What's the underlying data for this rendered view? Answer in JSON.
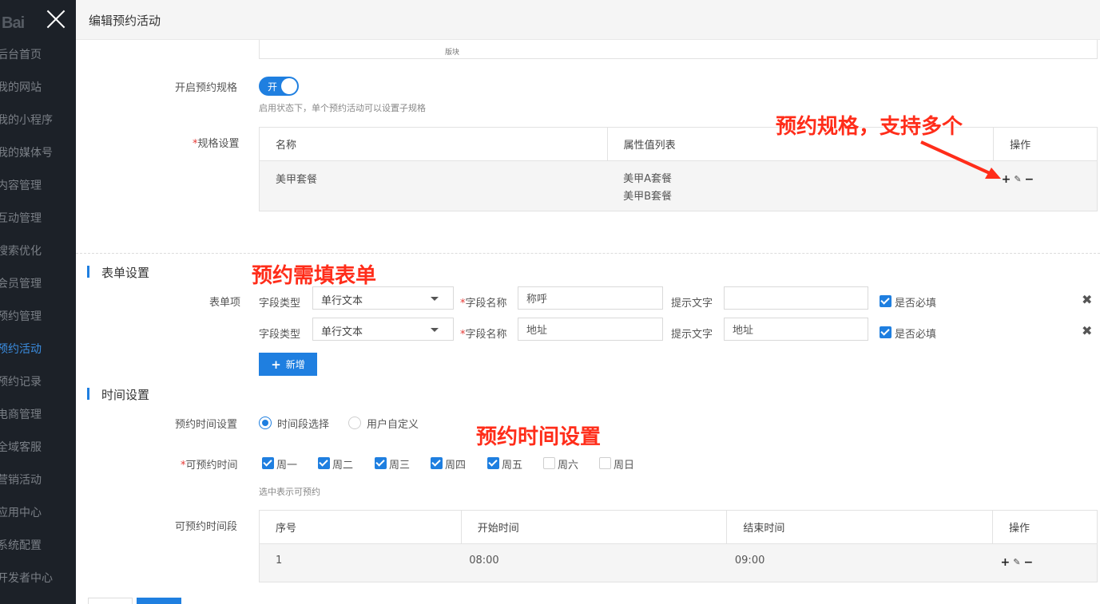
{
  "sidebar": {
    "logo_text": "Bai",
    "items": [
      {
        "label": "后台首页"
      },
      {
        "label": "我的网站"
      },
      {
        "label": "我的小程序"
      },
      {
        "label": "我的媒体号"
      },
      {
        "label": "内容管理"
      },
      {
        "label": "互动管理"
      },
      {
        "label": "搜索优化"
      },
      {
        "label": "会员管理"
      },
      {
        "label": "预约管理"
      },
      {
        "label": "预约活动"
      },
      {
        "label": "预约记录"
      },
      {
        "label": "电商管理"
      },
      {
        "label": "全域客服"
      },
      {
        "label": "营销活动"
      },
      {
        "label": "应用中心"
      },
      {
        "label": "系统配置"
      },
      {
        "label": "开发者中心"
      }
    ],
    "active_index": 9
  },
  "header": {
    "title": "编辑预约活动"
  },
  "top_box": {
    "caption": "版块"
  },
  "spec": {
    "enable_label": "开启预约规格",
    "switch_text": "开",
    "switch_on": true,
    "hint": "启用状态下，单个预约活动可以设置子规格",
    "settings_label": "规格设置",
    "table": {
      "headers": [
        "名称",
        "属性值列表",
        "操作"
      ],
      "rows": [
        {
          "name": "美甲套餐",
          "values": [
            "美甲A套餐",
            "美甲B套餐"
          ]
        }
      ]
    }
  },
  "form": {
    "section_title": "表单设置",
    "item_label": "表单项",
    "field_type_label": "字段类型",
    "field_name_label": "字段名称",
    "hint_label": "提示文字",
    "required_label": "是否必填",
    "rows": [
      {
        "type": "单行文本",
        "name": "称呼",
        "hint": "",
        "required": true
      },
      {
        "type": "单行文本",
        "name": "地址",
        "hint": "地址",
        "required": true
      }
    ],
    "add_button": "新增"
  },
  "time": {
    "section_title": "时间设置",
    "mode_label": "预约时间设置",
    "mode_options": [
      "时间段选择",
      "用户自定义"
    ],
    "mode_selected": 0,
    "days_label": "可预约时间",
    "days": [
      {
        "label": "周一",
        "checked": true
      },
      {
        "label": "周二",
        "checked": true
      },
      {
        "label": "周三",
        "checked": true
      },
      {
        "label": "周四",
        "checked": true
      },
      {
        "label": "周五",
        "checked": true
      },
      {
        "label": "周六",
        "checked": false
      },
      {
        "label": "周日",
        "checked": false
      }
    ],
    "days_hint": "选中表示可预约",
    "slots_label": "可预约时间段",
    "slots_table": {
      "headers": [
        "序号",
        "开始时间",
        "结束时间",
        "操作"
      ],
      "rows": [
        {
          "index": "1",
          "start": "08:00",
          "end": "09:00"
        }
      ]
    }
  },
  "annotations": {
    "spec": "预约规格，支持多个",
    "form": "预约需填表单",
    "time": "预约时间设置",
    "color": "#ff2d1a"
  },
  "ops_icons": [
    "plus-icon",
    "pencil-icon",
    "minus-icon"
  ],
  "colors": {
    "accent": "#1f7fe0",
    "sidebar_bg": "#1c2128",
    "required": "#e53935"
  }
}
